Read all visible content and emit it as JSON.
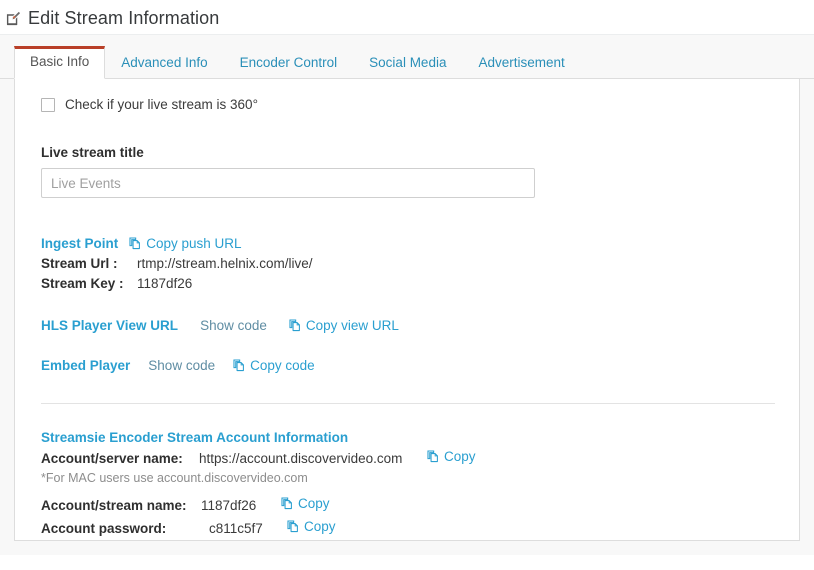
{
  "header": {
    "icon": "edit-pencil-square-icon",
    "title": "Edit Stream Information"
  },
  "tabs": [
    {
      "label": "Basic Info",
      "active": true
    },
    {
      "label": "Advanced Info",
      "active": false
    },
    {
      "label": "Encoder Control",
      "active": false
    },
    {
      "label": "Social Media",
      "active": false
    },
    {
      "label": "Advertisement",
      "active": false
    }
  ],
  "basic_info": {
    "checkbox_360": {
      "label": "Check if your live stream is 360°",
      "checked": false
    },
    "title_field": {
      "label": "Live stream title",
      "value": "",
      "placeholder": "Live Events"
    },
    "ingest": {
      "heading": "Ingest Point",
      "copy_push_label": "Copy push URL",
      "stream_url_label": "Stream Url :",
      "stream_url_value": "rtmp://stream.helnix.com/live/",
      "stream_key_label": "Stream Key :",
      "stream_key_value": "1187df26"
    },
    "hls": {
      "heading": "HLS Player View URL",
      "show_code_label": "Show code",
      "copy_label": "Copy view URL"
    },
    "embed": {
      "heading": "Embed Player",
      "show_code_label": "Show code",
      "copy_label": "Copy code"
    },
    "account": {
      "heading": "Streamsie Encoder Stream Account Information",
      "server_label": "Account/server name:",
      "server_value": "https://account.discovervideo.com",
      "server_copy_label": "Copy",
      "mac_note": "*For MAC users use account.discovervideo.com",
      "stream_name_label": "Account/stream name:",
      "stream_name_value": "1187df26",
      "stream_name_copy_label": "Copy",
      "password_label": "Account password:",
      "password_value": "c811c5f7",
      "password_copy_label": "Copy"
    }
  },
  "colors": {
    "link_blue": "#2a9fd0",
    "active_tab_border": "#b93f28",
    "panel_border": "#dddddd",
    "tab_strip_bg": "#f8f8f8",
    "muted_text": "#8d8d8d"
  }
}
